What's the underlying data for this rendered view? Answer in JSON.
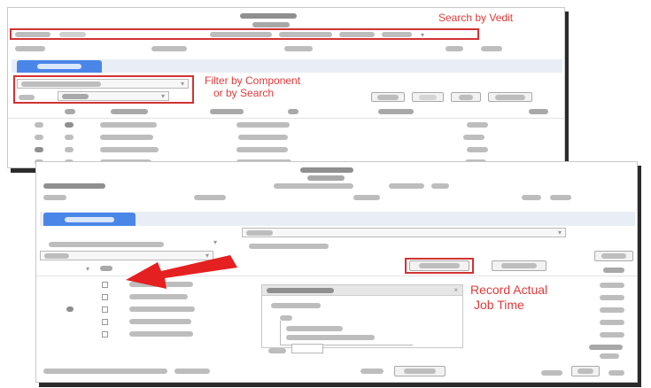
{
  "annotations": {
    "search": "Search by Vedit",
    "filter_line1": "Filter by Component",
    "filter_line2": "or by Search",
    "record_line1": "Record Actual",
    "record_line2": "Job Time"
  },
  "colors": {
    "annotation": "#e03a3a",
    "tab": "#4a86e8",
    "arrow": "#e42020",
    "shadow": "#2b2b2b"
  },
  "icons": {
    "arrow": "red-arrow-pointer-icon",
    "dropdown": "chevron-down-icon"
  }
}
